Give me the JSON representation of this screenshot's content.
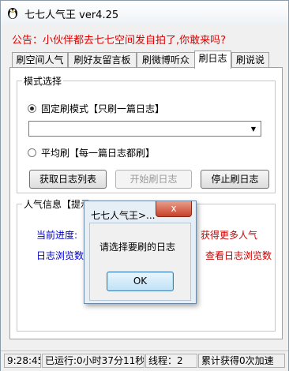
{
  "window": {
    "title": "七七人气王 ver4.25",
    "icon": "penguin-icon"
  },
  "notice": "公告：小伙伴都去七七空间发自拍了,你敢来吗?",
  "tabs": [
    "刷空间人气",
    "刷好友留言板",
    "刷微博听众",
    "刷日志",
    "刷说说"
  ],
  "active_tab": "刷日志",
  "mode_group": {
    "label": "模式选择",
    "fixed_mode": {
      "label": "固定刷模式【只刷一篇日志】",
      "selected": true
    },
    "combo_value": "",
    "average_mode": {
      "label": "平均刷【每一篇日志都刷】",
      "selected": false
    },
    "buttons": {
      "fetch": "获取日志列表",
      "start": "开始刷日志",
      "stop": "停止刷日志"
    }
  },
  "info_group": {
    "label": "人气信息【提示",
    "current_progress": "当前进度:",
    "get_more": "获得更多人气",
    "blog_views": "日志浏览数",
    "view_blog_views": "查看日志浏览数"
  },
  "statusbar": {
    "time": "9:28:45",
    "runtime": "已运行:0小时37分11秒",
    "threads": "线程：2",
    "total": "累计获得0次加速"
  },
  "dialog": {
    "title": "七七人气王>...",
    "message": "请选择要刷的日志",
    "ok": "OK",
    "close": "x"
  },
  "colors": {
    "notice": "#e00000",
    "info_blue": "#0000cc",
    "info_red": "#cc0000",
    "dialog_close": "#c8412b"
  }
}
